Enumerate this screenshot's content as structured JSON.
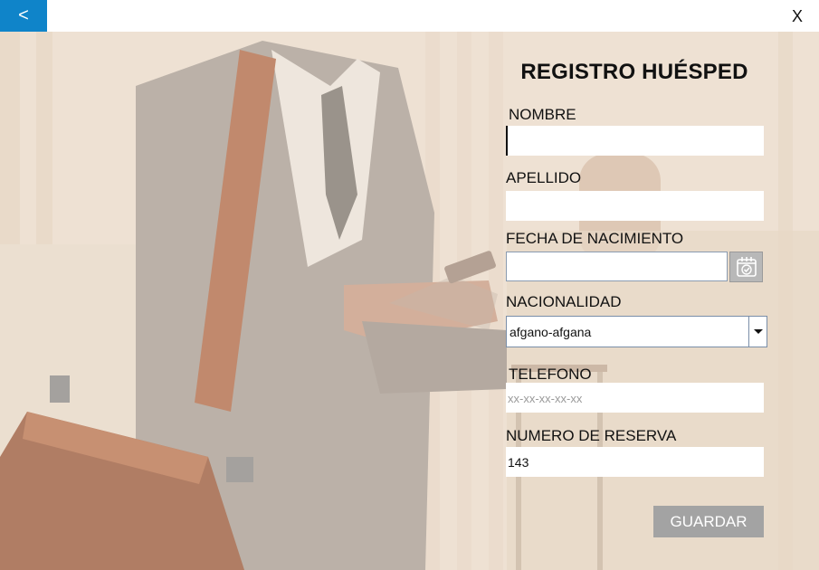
{
  "window": {
    "back_label": "<",
    "close_label": "X",
    "accent_color": "#0f84c9"
  },
  "form": {
    "title": "REGISTRO HUÉSPED",
    "nombre": {
      "label": "NOMBRE",
      "value": ""
    },
    "apellido": {
      "label": "APELLIDO",
      "value": ""
    },
    "fecha_nacimiento": {
      "label": "FECHA DE NACIMIENTO",
      "value": "",
      "icon": "calendar-check-icon"
    },
    "nacionalidad": {
      "label": "NACIONALIDAD",
      "selected": "afgano-afgana"
    },
    "telefono": {
      "label": "TELEFONO",
      "placeholder": "xx-xx-xx-xx-xx",
      "value": ""
    },
    "numero_reserva": {
      "label": "NUMERO DE RESERVA",
      "value": "143"
    },
    "save_label": "GUARDAR",
    "save_color": "#a3a3a3"
  }
}
